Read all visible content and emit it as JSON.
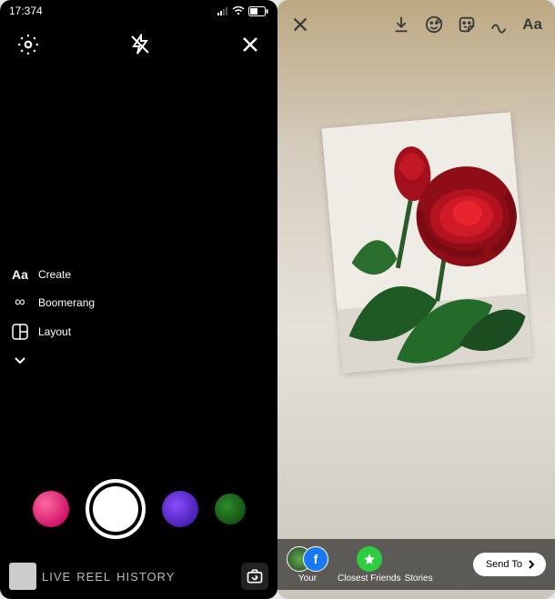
{
  "left": {
    "status_time": "17:374",
    "modes": {
      "create": "Create",
      "boomerang": "Boomerang",
      "layout": "Layout"
    },
    "tabs": {
      "live": "LIVE",
      "reel": "REEL",
      "history": "HISTORY"
    }
  },
  "right": {
    "audience": {
      "your_story": "Your",
      "close_friends": "Closest Friends",
      "stories": "Stories"
    },
    "send_to": "Send To"
  }
}
